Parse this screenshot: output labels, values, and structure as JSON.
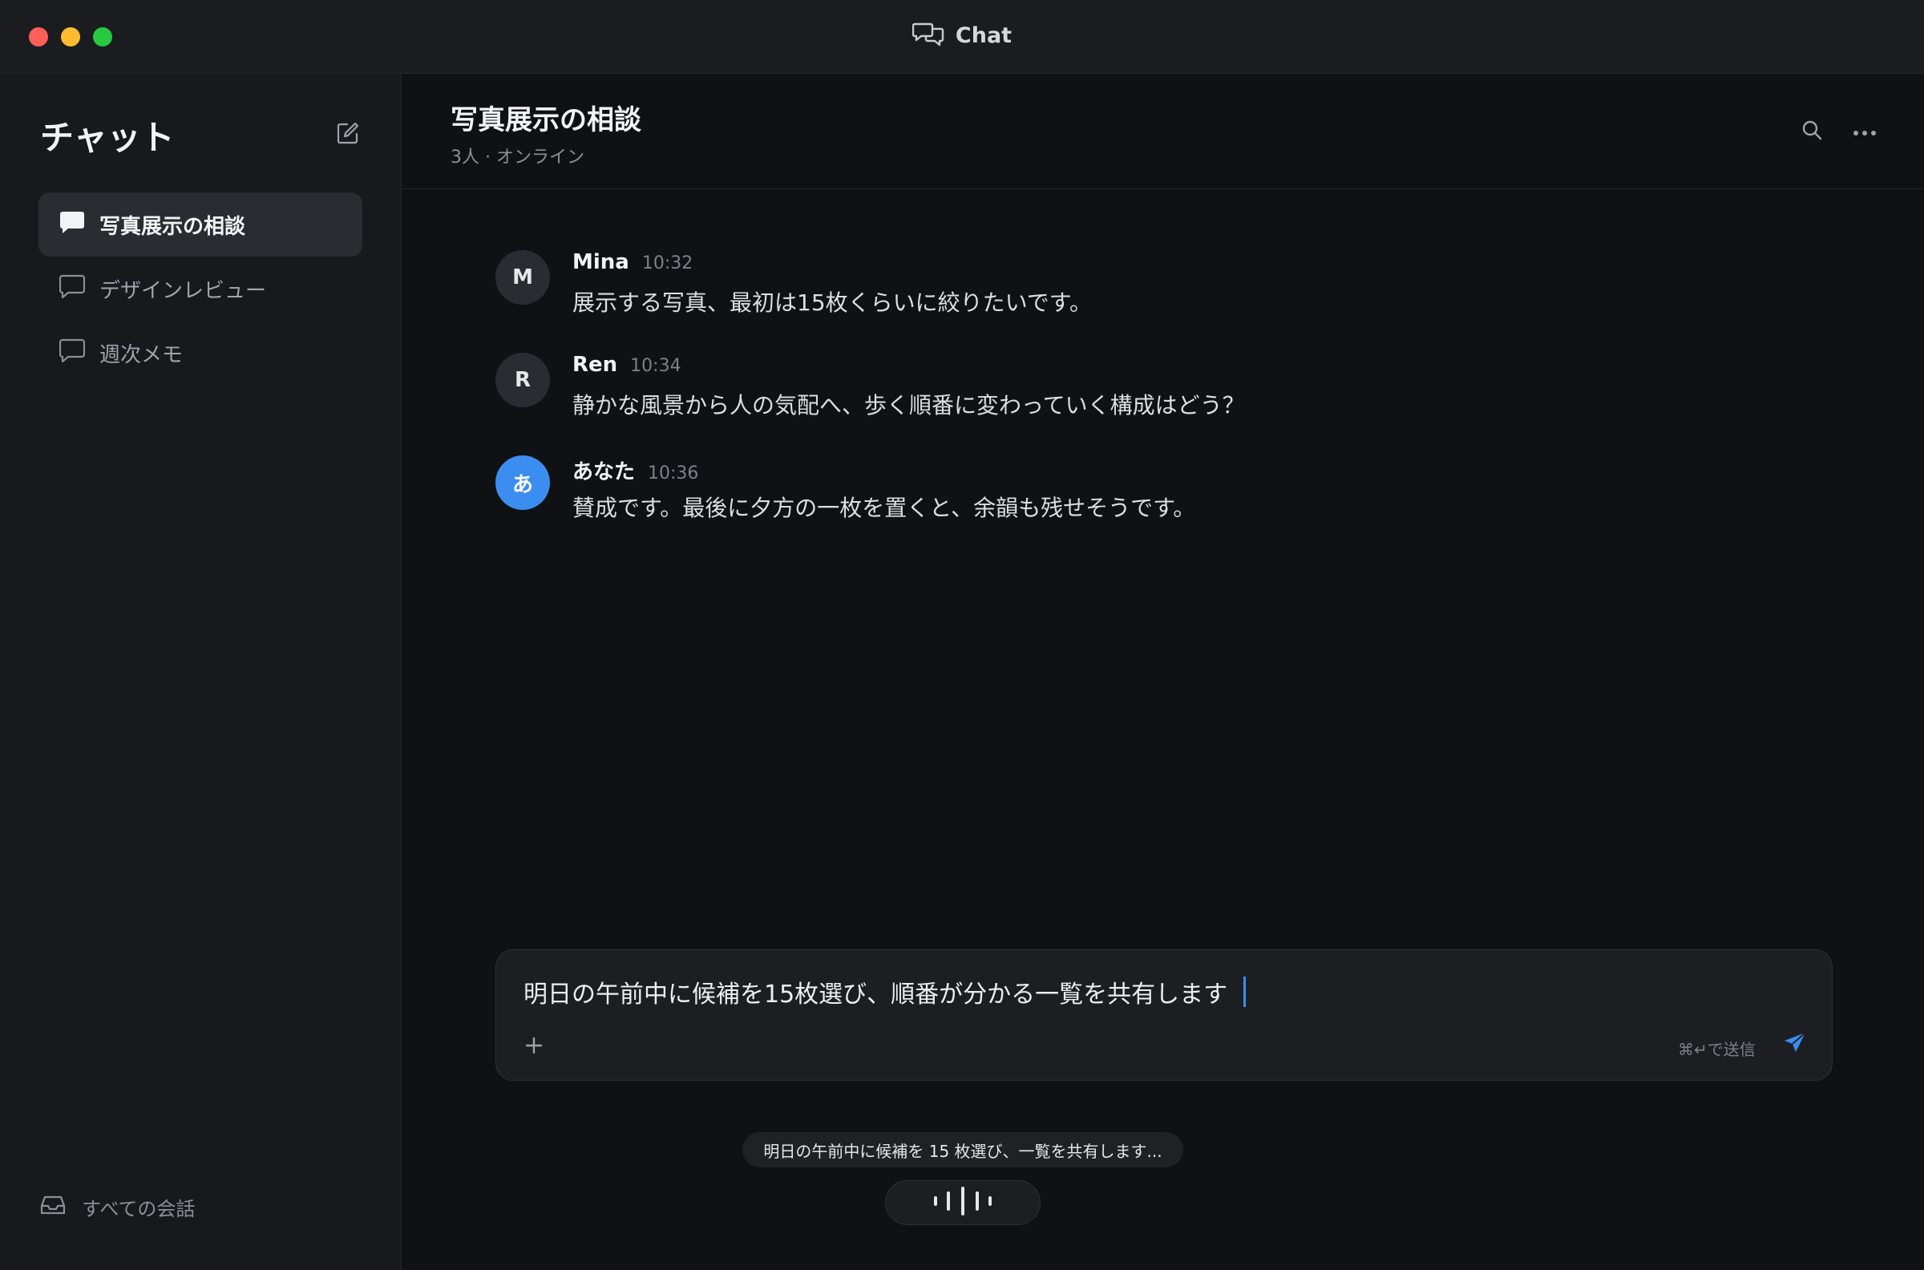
{
  "window": {
    "title": "Chat"
  },
  "sidebar": {
    "title": "チャット",
    "conversations": [
      {
        "label": "写真展示の相談",
        "active": true
      },
      {
        "label": "デザインレビュー",
        "active": false
      },
      {
        "label": "週次メモ",
        "active": false
      }
    ],
    "footer_label": "すべての会話"
  },
  "chat": {
    "title": "写真展示の相談",
    "subtitle": "3人 · オンライン",
    "messages": [
      {
        "initial": "M",
        "name": "Mina",
        "time": "10:32",
        "text": "展示する写真、最初は15枚くらいに絞りたいです。"
      },
      {
        "initial": "R",
        "name": "Ren",
        "time": "10:34",
        "text": "静かな風景から人の気配へ、歩く順番に変わっていく構成はどう？"
      },
      {
        "initial": "あ",
        "name": "あなた",
        "time": "10:36",
        "text": "賛成です。最後に夕方の一枚を置くと、余韻も残せそうです。"
      }
    ]
  },
  "composer": {
    "value": "明日の午前中に候補を15枚選び、順番が分かる一覧を共有します",
    "send_hint": "⌘↵で送信"
  },
  "voice": {
    "transcript": "明日の午前中に候補を 15 枚選び、一覧を共有します..."
  },
  "colors": {
    "accent": "#3b8ef0",
    "background": "#0f1115",
    "sidebar": "#17191d"
  }
}
